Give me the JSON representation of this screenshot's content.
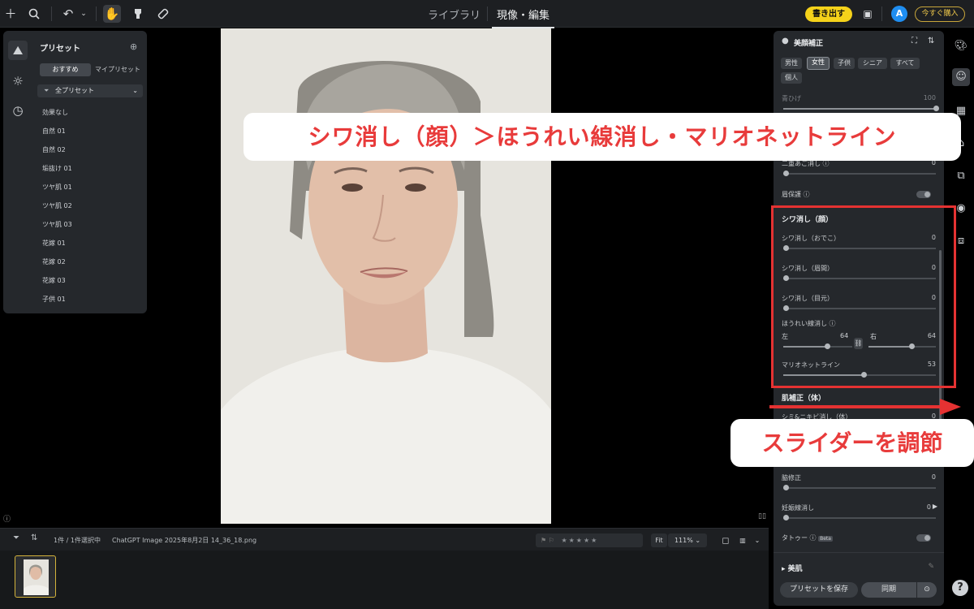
{
  "topbar": {
    "tabs": [
      {
        "label": "ライブラリ",
        "active": false
      },
      {
        "label": "現像・編集",
        "active": true
      }
    ],
    "export_label": "書き出す",
    "avatar_letter": "A",
    "buy_label": "今すぐ購入",
    "icons": [
      "plus-icon",
      "search-icon",
      "undo-icon",
      "chevron-down-icon",
      "hand-icon",
      "brush-icon",
      "eraser-icon",
      "compare-icon"
    ]
  },
  "presets": {
    "title": "プリセット",
    "tabs": [
      {
        "label": "おすすめ",
        "active": true
      },
      {
        "label": "マイプリセット",
        "active": false
      }
    ],
    "select_value": "全プリセット",
    "items": [
      "効果なし",
      "自然 01",
      "自然 02",
      "垢抜け 01",
      "ツヤ肌 01",
      "ツヤ肌 02",
      "ツヤ肌 03",
      "花嫁 01",
      "花嫁 02",
      "花嫁 03",
      "子供 01"
    ]
  },
  "filmbar": {
    "count_text": "1件 / 1件選択中",
    "filename": "ChatGPT Image 2025年8月2日 14_36_18.png",
    "fit_label": "Fit",
    "zoom_label": "111%",
    "rating": 0
  },
  "right_panel": {
    "title": "美顔補正",
    "chips": [
      {
        "label": "男性",
        "active": false
      },
      {
        "label": "女性",
        "active": true
      },
      {
        "label": "子供",
        "active": false
      },
      {
        "label": "シニア",
        "active": false
      },
      {
        "label": "すべて",
        "active": false
      },
      {
        "label": "個人",
        "active": false
      }
    ],
    "sliders_top": [
      {
        "label": "青ひげ",
        "value": "100",
        "fraction": 1.0
      },
      {
        "label": "二重あご消し",
        "value": "0",
        "fraction": 0.0
      }
    ],
    "eyebrow_protect": "眉保護",
    "wrinkle_section": "シワ消し（顔）",
    "wrinkle_sliders": [
      {
        "label": "シワ消し（おでこ）",
        "value": "0",
        "fraction": 0.0
      },
      {
        "label": "シワ消し（眉間）",
        "value": "0",
        "fraction": 0.0
      },
      {
        "label": "シワ消し（目元）",
        "value": "0",
        "fraction": 0.0
      }
    ],
    "nasolabial": {
      "label": "ほうれい線消し",
      "left_label": "左",
      "left_value": "64",
      "left_fraction": 0.64,
      "right_label": "右",
      "right_value": "64",
      "right_fraction": 0.64
    },
    "marionette": {
      "label": "マリオネットライン",
      "value": "53",
      "fraction": 0.53
    },
    "body_section": "肌補正（体）",
    "body_sliders": [
      {
        "label": "シミ&ニキビ消し（体）",
        "value": "0",
        "fraction": 0.0
      },
      {
        "label": "脇修正",
        "value": "0",
        "fraction": 0.0
      },
      {
        "label": "妊娠線消し",
        "value": "0",
        "fraction": 0.0
      }
    ],
    "tattoo_label": "タトゥー",
    "beta_label": "Beta",
    "skin_section": "美肌",
    "save_preset_label": "プリセットを保存",
    "sync_label": "同期"
  },
  "annotations": {
    "callout_top": "シワ消し（顔）＞ほうれい線消し・マリオネットライン",
    "callout_bottom": "スライダーを調節"
  },
  "colors": {
    "accent_yellow": "#f5d21a",
    "annotation_red": "#e53232",
    "panel_bg": "#25282c"
  }
}
